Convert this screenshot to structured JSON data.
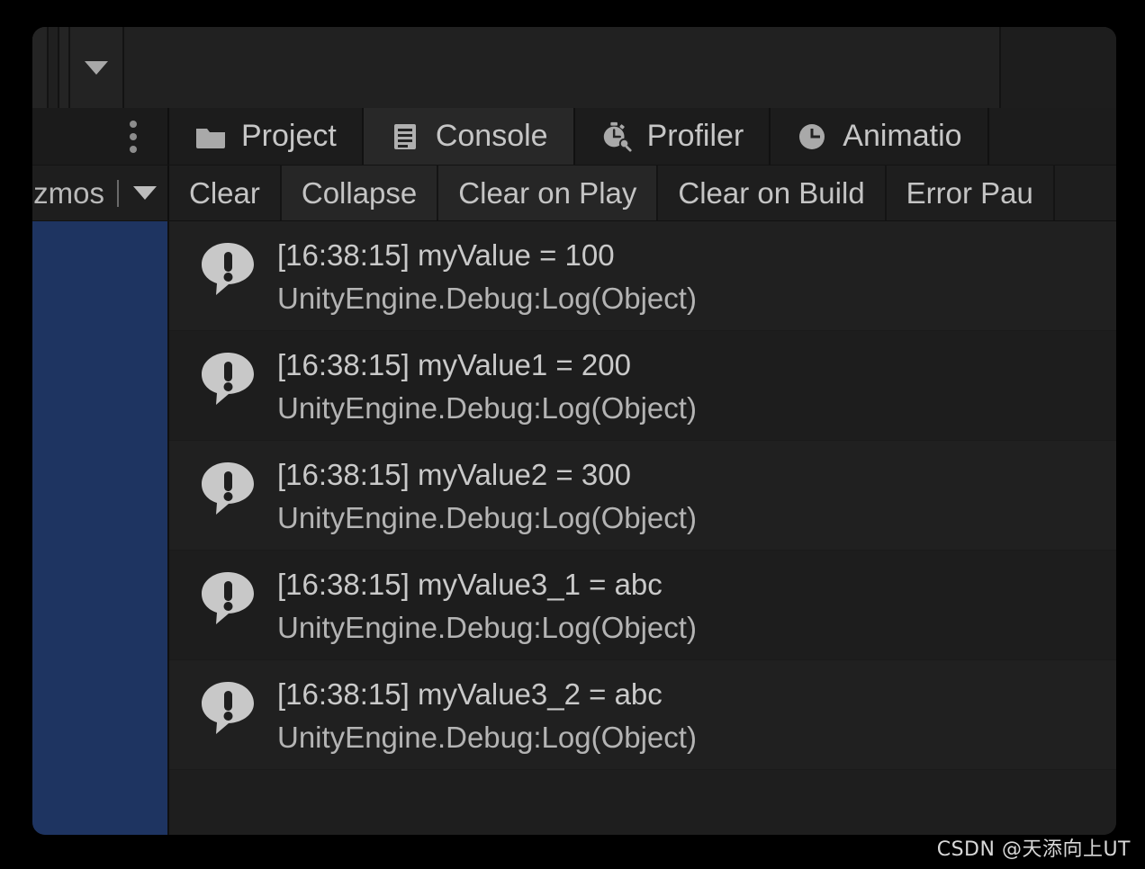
{
  "window": {
    "title": "Unity Editor - Console",
    "background_color": "#1b1b1b",
    "selection_color": "#1e3461"
  },
  "top_chrome": {
    "dropdown_icon": "chevron-down-icon",
    "search_field_value": ""
  },
  "tab_strip": {
    "menu_icon": "kebab-menu-icon",
    "tabs": [
      {
        "label": "Project",
        "icon": "folder-icon",
        "active": false
      },
      {
        "label": "Console",
        "icon": "console-list-icon",
        "active": true
      },
      {
        "label": "Profiler",
        "icon": "stopwatch-icon",
        "active": false
      },
      {
        "label": "Animatio",
        "icon": "clock-icon",
        "active": false
      }
    ]
  },
  "console_toolbar": {
    "gizmos_label": "zmos",
    "gizmos_dropdown_icon": "chevron-down-icon",
    "buttons": [
      {
        "label": "Clear",
        "toggled": false
      },
      {
        "label": "Collapse",
        "toggled": true
      },
      {
        "label": "Clear on Play",
        "toggled": true
      },
      {
        "label": "Clear on Build",
        "toggled": false
      },
      {
        "label": "Error Pau",
        "toggled": false
      }
    ]
  },
  "log_entries": [
    {
      "icon": "info-log-icon",
      "message": "[16:38:15] myValue = 100",
      "stacktrace": "UnityEngine.Debug:Log(Object)"
    },
    {
      "icon": "info-log-icon",
      "message": "[16:38:15] myValue1 = 200",
      "stacktrace": "UnityEngine.Debug:Log(Object)"
    },
    {
      "icon": "info-log-icon",
      "message": "[16:38:15] myValue2 = 300",
      "stacktrace": "UnityEngine.Debug:Log(Object)"
    },
    {
      "icon": "info-log-icon",
      "message": "[16:38:15] myValue3_1 = abc",
      "stacktrace": "UnityEngine.Debug:Log(Object)"
    },
    {
      "icon": "info-log-icon",
      "message": "[16:38:15] myValue3_2 = abc",
      "stacktrace": "UnityEngine.Debug:Log(Object)"
    }
  ],
  "watermark": {
    "text": "CSDN @天添向上UT"
  }
}
